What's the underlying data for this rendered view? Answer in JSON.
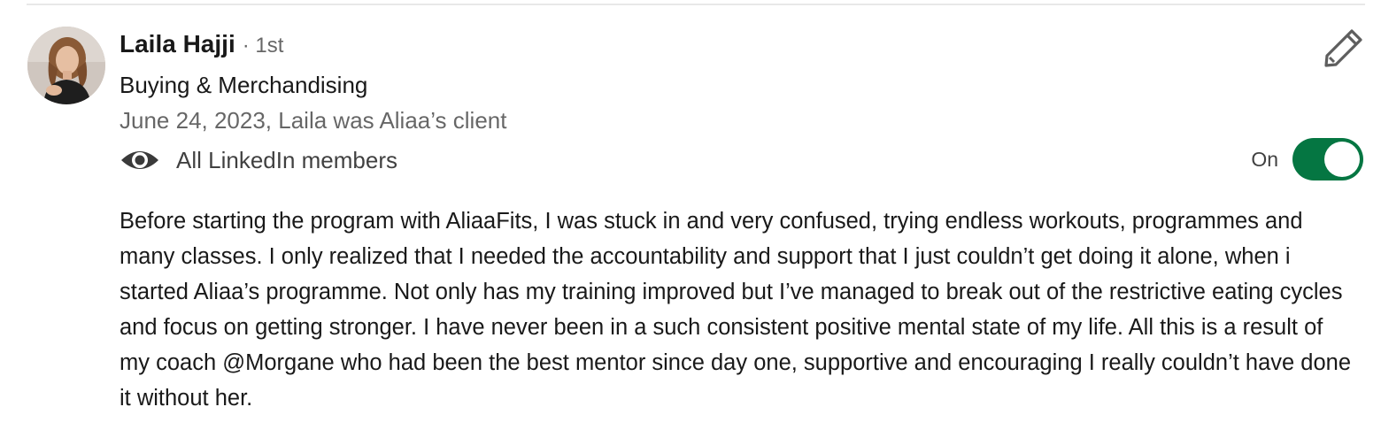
{
  "recommendation": {
    "author_name": "Laila Hajji",
    "connection_degree": "· 1st",
    "headline": "Buying & Merchandising",
    "meta": "June 24, 2023, Laila was Aliaa’s client",
    "visibility_label": "All LinkedIn members",
    "visibility_icon": "eye-icon",
    "toggle_label": "On",
    "toggle_state": "on",
    "toggle_color": "#057642",
    "edit_icon": "pencil-icon",
    "text": "Before starting the program with AliaaFits, I was stuck in and very confused, trying endless workouts, programmes and many classes. I only realized that I needed the accountability and support that I just couldn’t get doing it alone, when i started Aliaa’s programme. Not only has my training improved but I’ve managed to break out of the restrictive eating cycles and focus on getting stronger. I have never been in a such consistent positive mental state of my life. All this is a result of my coach @Morgane who had been the best mentor since day one, supportive and encouraging I really couldn’t have done it without her."
  }
}
